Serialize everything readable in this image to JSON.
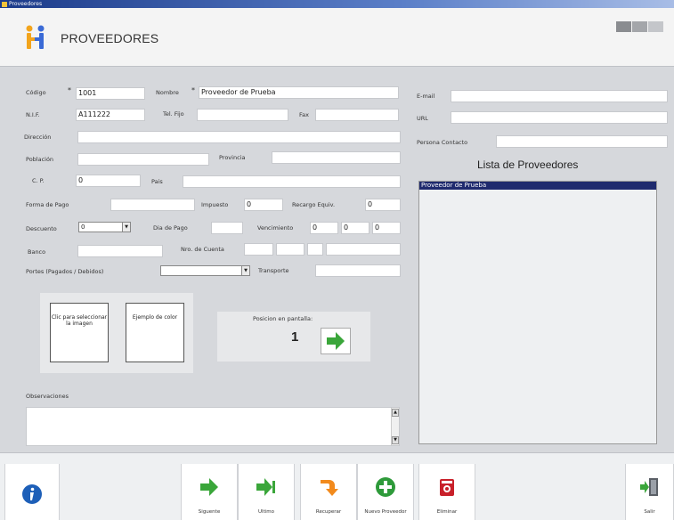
{
  "window": {
    "title": "Proveedores"
  },
  "header": {
    "title": "PROVEEDORES"
  },
  "colors": {
    "accent": "#1f2a6e",
    "arrow_green": "#3aa63a",
    "info_blue": "#1d5fb8",
    "logo_orange": "#f2a41c",
    "logo_blue": "#3a6ad6"
  },
  "form": {
    "codigo": {
      "label": "Código",
      "value": "1001",
      "required": "*"
    },
    "nombre": {
      "label": "Nombre",
      "value": "Proveedor de Prueba",
      "required": "*"
    },
    "nif": {
      "label": "N.I.F.",
      "value": "A111222"
    },
    "tel_fijo": {
      "label": "Tel. Fijo",
      "value": ""
    },
    "fax": {
      "label": "Fax",
      "value": ""
    },
    "direccion": {
      "label": "Dirección",
      "value": ""
    },
    "poblacion": {
      "label": "Población",
      "value": ""
    },
    "provincia": {
      "label": "Provincia",
      "value": ""
    },
    "cp": {
      "label": "C. P.",
      "value": "0"
    },
    "pais": {
      "label": "Pais",
      "value": ""
    },
    "forma_pago": {
      "label": "Forma de Pago",
      "value": ""
    },
    "impuesto": {
      "label": "Impuesto",
      "value": "0"
    },
    "recargo": {
      "label": "Recargo Equiv.",
      "value": "0"
    },
    "descuento": {
      "label": "Descuento",
      "value": "0"
    },
    "dia_pago": {
      "label": "Dia de Pago",
      "value": ""
    },
    "vencimiento": {
      "label": "Vencimiento",
      "values": [
        "0",
        "0",
        "0"
      ]
    },
    "banco": {
      "label": "Banco",
      "value": ""
    },
    "nro_cuenta": {
      "label": "Nro. de Cuenta"
    },
    "portes": {
      "label": "Portes (Pagados / Debidos)",
      "value": ""
    },
    "transporte": {
      "label": "Transporte",
      "value": ""
    },
    "email": {
      "label": "E-mail",
      "value": ""
    },
    "url": {
      "label": "URL",
      "value": ""
    },
    "persona_contacto": {
      "label": "Persona Contacto",
      "value": ""
    },
    "observaciones": {
      "label": "Observaciones",
      "value": ""
    }
  },
  "image_panel": {
    "select_image": "Clic para seleccionar la imagen",
    "color_sample": "Ejemplo de color"
  },
  "position_panel": {
    "label": "Posicion en pantalla:",
    "value": "1"
  },
  "supplier_list": {
    "title": "Lista de Proveedores",
    "items": [
      "Proveedor de Prueba"
    ]
  },
  "toolbar": {
    "info": "",
    "siguiente": "Siguente",
    "ultimo": "Ultimo",
    "recuperar": "Recuperar",
    "nuevo": "Nuevo Proveedor",
    "eliminar": "Eliminar",
    "salir": "Salir"
  }
}
